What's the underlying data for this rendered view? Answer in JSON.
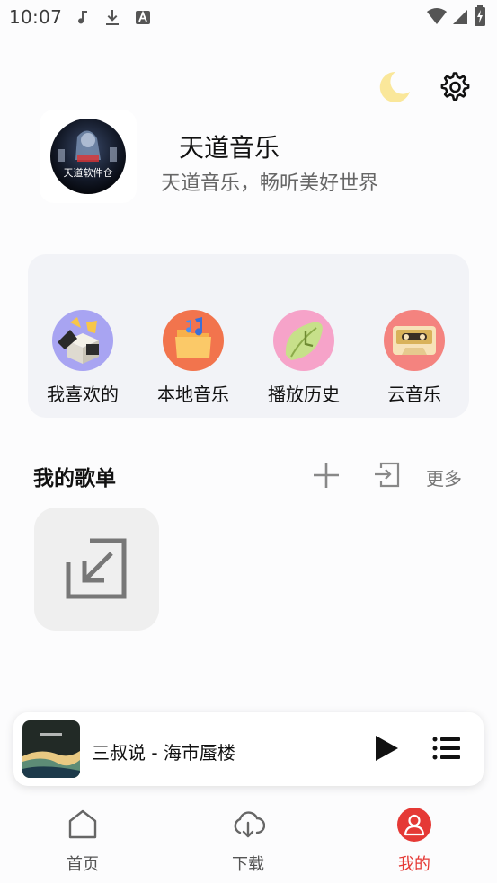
{
  "status_bar": {
    "time": "10:07",
    "icons": [
      "music-note-icon",
      "download-icon",
      "font-a-icon",
      "wifi-icon",
      "signal-icon",
      "battery-charging-icon"
    ]
  },
  "header": {
    "icons": [
      "moon-icon",
      "gear-icon"
    ],
    "moon_color": "#fae79a"
  },
  "profile": {
    "name": "天道音乐",
    "subtitle": "天道音乐，畅听美好世界",
    "avatar_text": "天道软件仓"
  },
  "quick_actions": [
    {
      "label": "我喜欢的",
      "icon": "favorites-box-icon",
      "bg": "#a8a4f2"
    },
    {
      "label": "本地音乐",
      "icon": "folder-music-icon",
      "bg": "#f2744d"
    },
    {
      "label": "播放历史",
      "icon": "history-leaf-icon",
      "bg": "#f6a3c9"
    },
    {
      "label": "云音乐",
      "icon": "cassette-icon",
      "bg": "#f4837f"
    }
  ],
  "playlists": {
    "title": "我的歌单",
    "more_label": "更多",
    "icons": [
      "add-icon",
      "import-icon",
      "import-arrow-icon"
    ]
  },
  "player": {
    "title": "三叔说 - 海市蜃楼",
    "icons": [
      "play-icon",
      "playlist-icon"
    ]
  },
  "nav": {
    "items": [
      {
        "label": "首页",
        "icon": "home-icon"
      },
      {
        "label": "下载",
        "icon": "cloud-download-icon"
      },
      {
        "label": "我的",
        "icon": "user-icon",
        "active": true
      }
    ],
    "active_color": "#e53935"
  }
}
